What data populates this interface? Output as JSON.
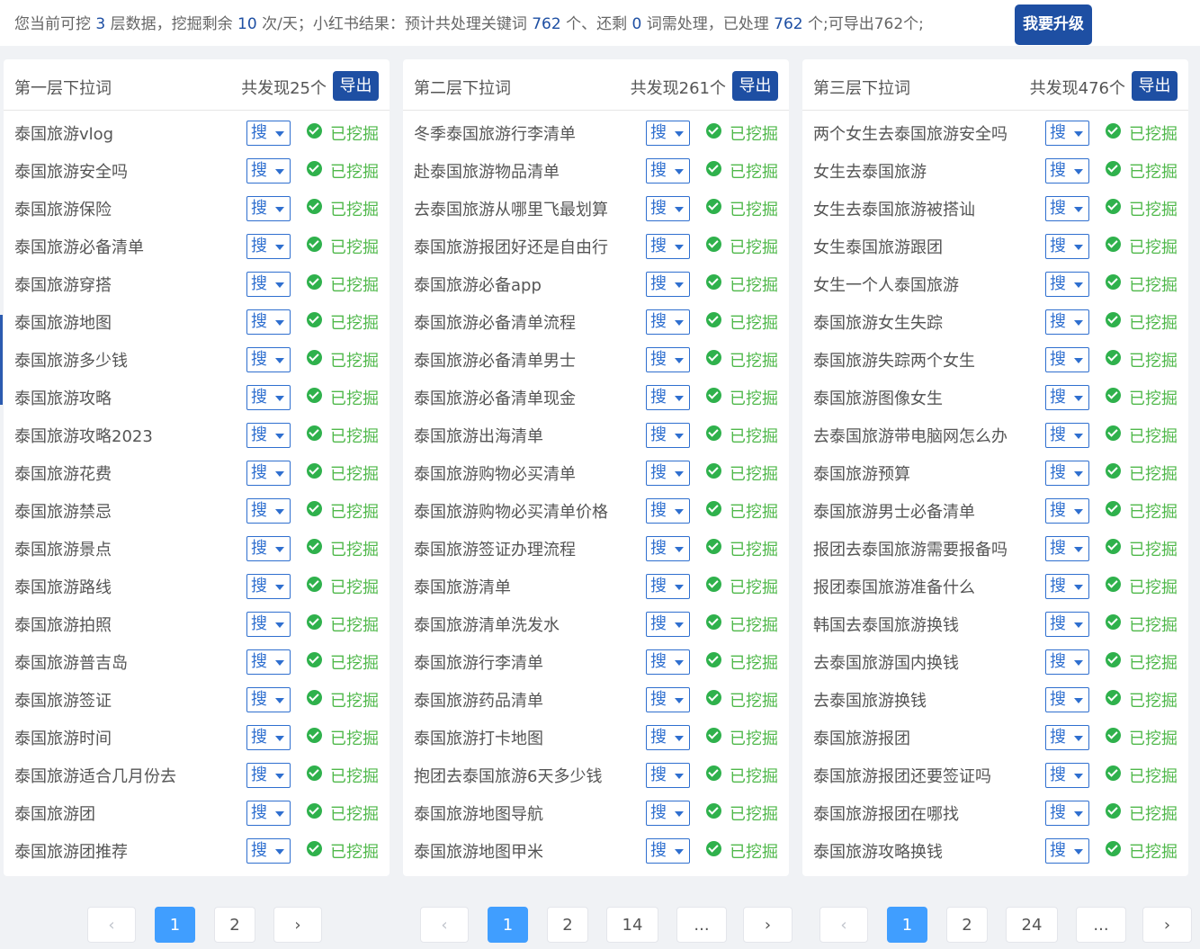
{
  "topbar": {
    "t1": "您当前可挖 ",
    "layers": "3",
    "t2": " 层数据，挖掘剩余 ",
    "remaining": "10",
    "t3": " 次/天；小红书结果：预计共处理关键词 ",
    "total": "762",
    "t4": " 个、还剩 ",
    "left": "0",
    "t5": " 词需处理，已处理 ",
    "processed": "762",
    "t6": " 个;可导出762个;",
    "upgrade_label": "我要升级"
  },
  "common": {
    "search_label": "搜",
    "status_label": "已挖掘",
    "export_label": "导出"
  },
  "panels": [
    {
      "title": "第一层下拉词",
      "count": "共发现25个",
      "keywords": [
        "泰国旅游vlog",
        "泰国旅游安全吗",
        "泰国旅游保险",
        "泰国旅游必备清单",
        "泰国旅游穿搭",
        "泰国旅游地图",
        "泰国旅游多少钱",
        "泰国旅游攻略",
        "泰国旅游攻略2023",
        "泰国旅游花费",
        "泰国旅游禁忌",
        "泰国旅游景点",
        "泰国旅游路线",
        "泰国旅游拍照",
        "泰国旅游普吉岛",
        "泰国旅游签证",
        "泰国旅游时间",
        "泰国旅游适合几月份去",
        "泰国旅游团",
        "泰国旅游团推荐"
      ],
      "pager": [
        "‹",
        "1",
        "2",
        "›"
      ]
    },
    {
      "title": "第二层下拉词",
      "count": "共发现261个",
      "keywords": [
        "冬季泰国旅游行李清单",
        "赴泰国旅游物品清单",
        "去泰国旅游从哪里飞最划算",
        "泰国旅游报团好还是自由行",
        "泰国旅游必备app",
        "泰国旅游必备清单流程",
        "泰国旅游必备清单男士",
        "泰国旅游必备清单现金",
        "泰国旅游出海清单",
        "泰国旅游购物必买清单",
        "泰国旅游购物必买清单价格",
        "泰国旅游签证办理流程",
        "泰国旅游清单",
        "泰国旅游清单洗发水",
        "泰国旅游行李清单",
        "泰国旅游药品清单",
        "泰国旅游打卡地图",
        "抱团去泰国旅游6天多少钱",
        "泰国旅游地图导航",
        "泰国旅游地图甲米"
      ],
      "pager": [
        "‹",
        "1",
        "2",
        "14",
        "...",
        "›"
      ]
    },
    {
      "title": "第三层下拉词",
      "count": "共发现476个",
      "keywords": [
        "两个女生去泰国旅游安全吗",
        "女生去泰国旅游",
        "女生去泰国旅游被搭讪",
        "女生泰国旅游跟团",
        "女生一个人泰国旅游",
        "泰国旅游女生失踪",
        "泰国旅游失踪两个女生",
        "泰国旅游图像女生",
        "去泰国旅游带电脑网怎么办",
        "泰国旅游预算",
        "泰国旅游男士必备清单",
        "报团去泰国旅游需要报备吗",
        "报团泰国旅游准备什么",
        "韩国去泰国旅游换钱",
        "去泰国旅游国内换钱",
        "去泰国旅游换钱",
        "泰国旅游报团",
        "泰国旅游报团还要签证吗",
        "泰国旅游报团在哪找",
        "泰国旅游攻略换钱"
      ],
      "pager": [
        "‹",
        "1",
        "2",
        "24",
        "...",
        "›"
      ]
    }
  ]
}
